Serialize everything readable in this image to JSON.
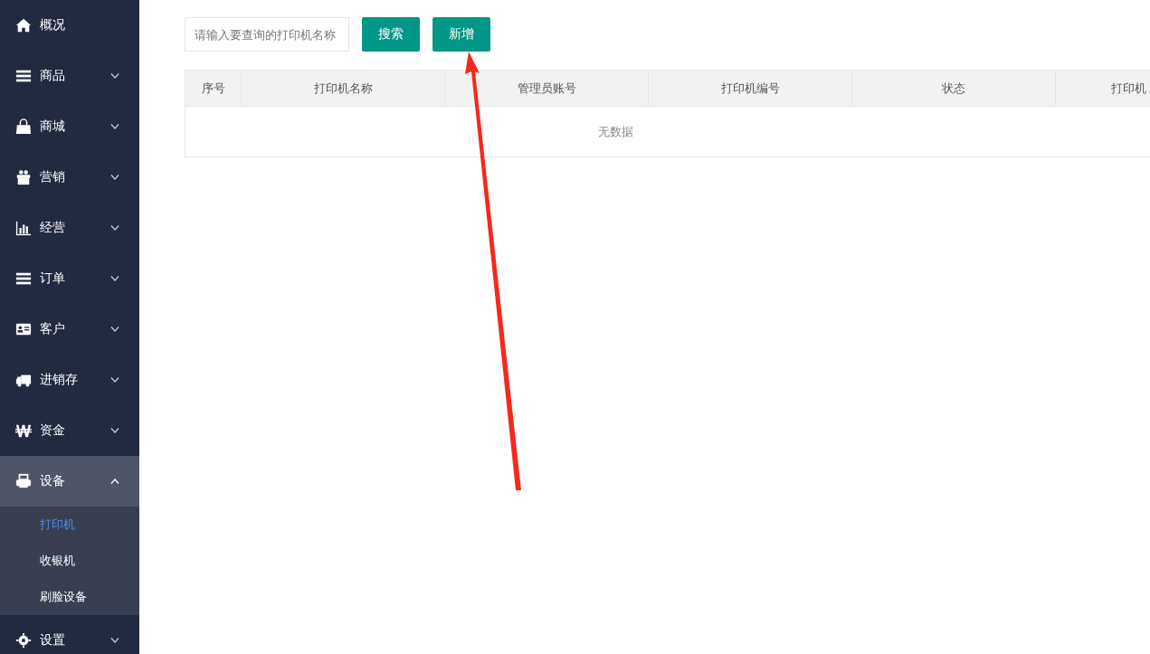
{
  "sidebar": {
    "items": [
      {
        "label": "概况",
        "selected": false
      },
      {
        "label": "商品",
        "expanded": false,
        "selected": false
      },
      {
        "label": "商城",
        "expanded": false,
        "selected": false
      },
      {
        "label": "营销",
        "expanded": false,
        "selected": false
      },
      {
        "label": "经营",
        "expanded": false,
        "selected": false
      },
      {
        "label": "订单",
        "expanded": false,
        "selected": false
      },
      {
        "label": "客户",
        "expanded": false,
        "selected": false
      },
      {
        "label": "进销存",
        "expanded": false,
        "selected": false
      },
      {
        "label": "资金",
        "expanded": false,
        "selected": false
      },
      {
        "label": "设备",
        "expanded": true,
        "selected": true,
        "children": [
          {
            "label": "打印机",
            "selected": true
          },
          {
            "label": "收银机",
            "selected": false
          },
          {
            "label": "刷脸设备",
            "selected": false
          }
        ]
      },
      {
        "label": "设置",
        "expanded": false,
        "selected": false
      }
    ]
  },
  "search": {
    "placeholder": "请输入要查询的打印机名称"
  },
  "buttons": [
    "搜索",
    "新增"
  ],
  "table": {
    "columns": [
      "序号",
      "打印机名称",
      "管理员账号",
      "打印机编号",
      "状态",
      "打印机"
    ],
    "empty_text": "无数据"
  }
}
